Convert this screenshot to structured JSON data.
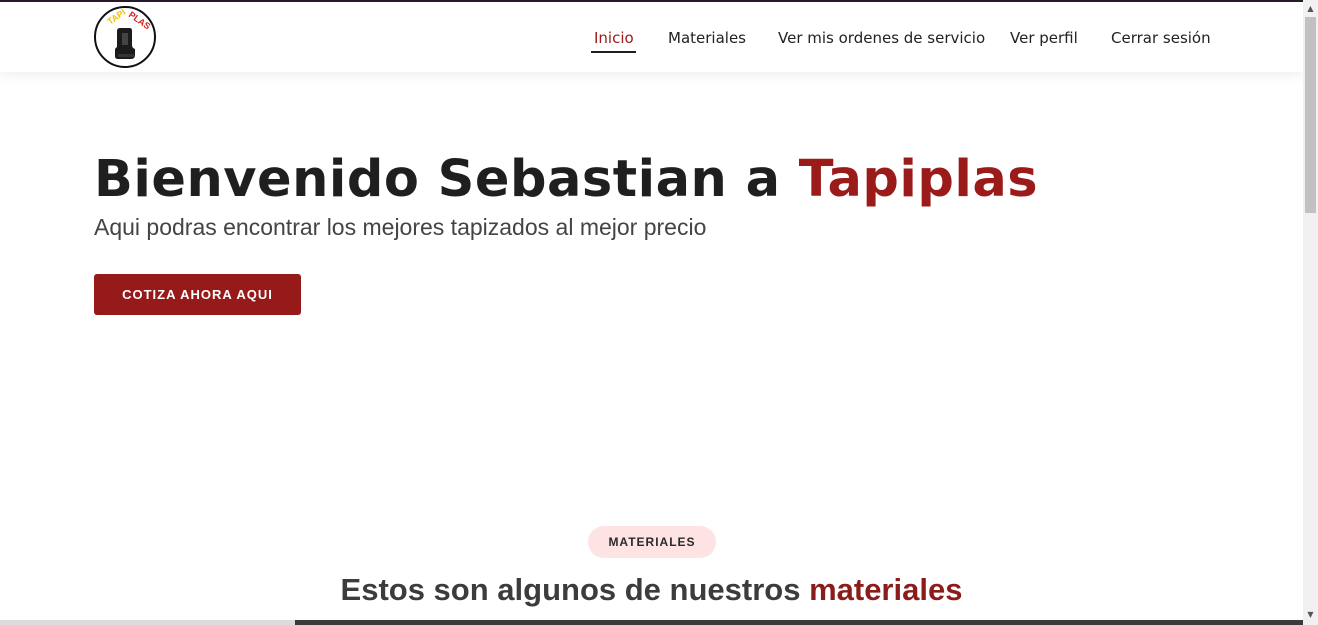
{
  "logo": {
    "text_top": "TAPI",
    "text_bottom": "PLAS",
    "icon": "car-seat-icon"
  },
  "nav": {
    "items": [
      {
        "label": "Inicio",
        "active": true
      },
      {
        "label": "Materiales"
      },
      {
        "label": "Ver mis ordenes de servicio"
      },
      {
        "label": "Ver perfil"
      },
      {
        "label": "Cerrar sesión"
      }
    ]
  },
  "hero": {
    "title_prefix": "Bienvenido Sebastian a ",
    "title_brand": "Tapiplas",
    "subtitle": "Aqui podras encontrar los mejores tapizados al mejor precio",
    "cta_label": "COTIZA AHORA AQUI"
  },
  "materials": {
    "badge": "MATERIALES",
    "title_prefix": "Estos son algunos de nuestros ",
    "title_accent": "materiales"
  },
  "colors": {
    "brand": "#9b1a1a",
    "badge_bg": "#fde3e3",
    "text_dark": "#1f1f1f"
  },
  "scrollbar": {
    "up_icon": "scroll-up-arrow-icon",
    "down_icon": "scroll-down-arrow-icon"
  }
}
